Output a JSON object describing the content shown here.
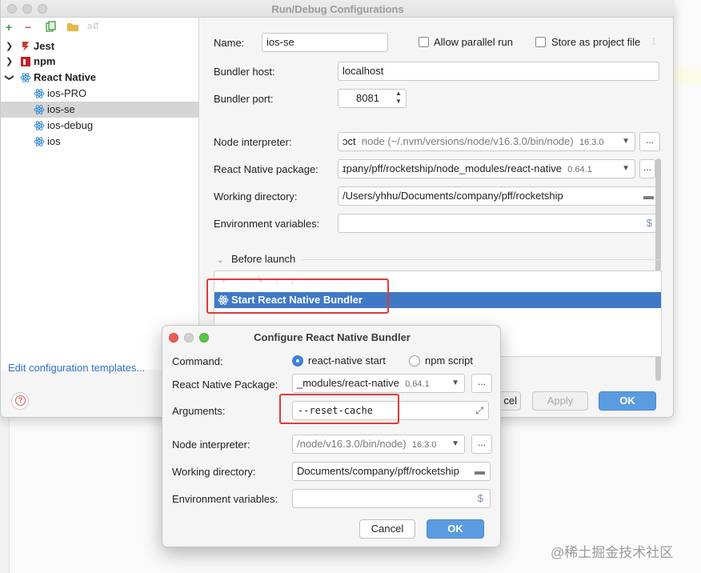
{
  "window": {
    "title": "Run/Debug Configurations"
  },
  "toolbar": {
    "add": "+",
    "remove": "−",
    "copy_icon": "copy-icon",
    "folder_icon": "folder-icon",
    "sort_icon": "sort-icon"
  },
  "tree": {
    "groups": [
      {
        "label": "Jest",
        "icon": "jest-icon"
      },
      {
        "label": "npm",
        "icon": "npm-icon"
      },
      {
        "label": "React Native",
        "icon": "react-icon"
      }
    ],
    "items": [
      "ios-PRO",
      "ios-se",
      "ios-debug",
      "ios"
    ],
    "selected": "ios-se"
  },
  "edit_templates_link": "Edit configuration templates...",
  "form": {
    "name_label": "Name:",
    "name_value": "ios-se",
    "allow_parallel_label": "Allow parallel run",
    "store_project_label": "Store as project file",
    "bundler_host_label": "Bundler host:",
    "bundler_host_value": "localhost",
    "bundler_port_label": "Bundler port:",
    "bundler_port_value": "8081",
    "node_interp_label": "Node interpreter:",
    "node_interp_prefix": "ɔct",
    "node_interp_path": "node (~/.nvm/versions/node/v16.3.0/bin/node)",
    "node_interp_version": "16.3.0",
    "rn_package_label": "React Native package:",
    "rn_package_value": "ɪpany/pff/rocketship/node_modules/react-native",
    "rn_package_version": "0.64.1",
    "working_dir_label": "Working directory:",
    "working_dir_value": "/Users/yhhu/Documents/company/pff/rocketship",
    "env_label": "Environment variables:",
    "env_value": "",
    "before_launch_label": "Before launch",
    "before_launch_item": "Start React Native Bundler",
    "more": "..."
  },
  "buttons": {
    "cancel": "cel",
    "apply": "Apply",
    "ok": "OK"
  },
  "subdialog": {
    "title": "Configure React Native Bundler",
    "command_label": "Command:",
    "command_options": [
      "react-native start",
      "npm script"
    ],
    "command_selected": "react-native start",
    "rn_package_label": "React Native Package:",
    "rn_package_value": "_modules/react-native",
    "rn_package_version": "0.64.1",
    "arguments_label": "Arguments:",
    "arguments_value": "--reset-cache",
    "node_interp_label": "Node interpreter:",
    "node_interp_value": "/node/v16.3.0/bin/node)",
    "node_interp_version": "16.3.0",
    "working_dir_label": "Working directory:",
    "working_dir_value": "Documents/company/pff/rocketship",
    "env_label": "Environment variables:",
    "env_value": "",
    "cancel": "Cancel",
    "ok": "OK"
  },
  "watermark": "@稀土掘金技术社区",
  "colors": {
    "selection_blue": "#3f79c6",
    "ok_blue": "#5b9bdf",
    "annotation_red": "#e23a3a",
    "link_blue": "#2f6ec9"
  }
}
